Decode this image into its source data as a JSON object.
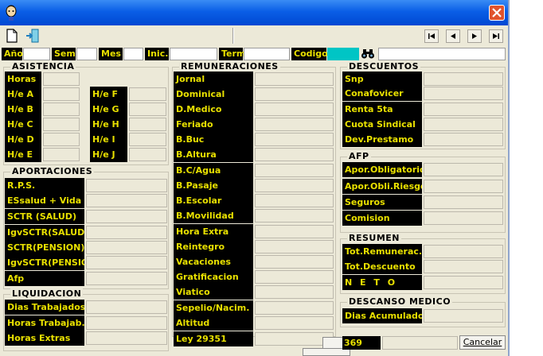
{
  "toolbar": {
    "new_icon": "new-document-icon",
    "exit_icon": "exit-door-icon",
    "nav": [
      "first-record-icon",
      "prev-record-icon",
      "next-record-icon",
      "last-record-icon"
    ]
  },
  "filter": {
    "anio": "Año",
    "sem": "Sem",
    "mes": "Mes",
    "inic": "Inic.",
    "term": "Term",
    "codigo": "Codigo",
    "search_icon": "binoculars-icon",
    "codigo_color": "#00c5c5"
  },
  "asistencia": {
    "title": "ASISTENCIA",
    "horas": "Horas",
    "left": [
      "H/e A",
      "H/e B",
      "H/e C",
      "H/e D",
      "H/e E"
    ],
    "right": [
      "H/e F",
      "H/e G",
      "H/e H",
      "H/e I",
      "H/e J"
    ]
  },
  "aportaciones": {
    "title": "APORTACIONES",
    "items": [
      "R.P.S.",
      "ESsalud + Vida",
      "SCTR (SALUD)",
      "IgvSCTR(SALUD",
      "SCTR(PENSION)",
      "IgvSCTR(PENSIO",
      "Afp"
    ]
  },
  "liquidacion": {
    "title": "LIQUIDACION",
    "items": [
      "Dias Trabajados",
      "Horas Trabajab.",
      "Horas Extras"
    ]
  },
  "remuneraciones": {
    "title": "REMUNERACIONES",
    "items": [
      "Jornal",
      "Dominical",
      "D.Medico",
      "Feriado",
      "B.Buc",
      "B.Altura",
      "B.C/Agua",
      "B.Pasaje",
      "B.Escolar",
      "B.Movilidad",
      "Hora Extra",
      "Reintegro",
      "Vacaciones",
      "Gratificacion",
      "Viatico",
      "Sepelio/Nacim.",
      "Altitud",
      "Ley 29351"
    ]
  },
  "descuentos": {
    "title": "DESCUENTOS",
    "items": [
      "Snp",
      "Conafovicer",
      "Renta 5ta",
      "Cuota Sindical",
      "Dev.Prestamo"
    ]
  },
  "afp": {
    "title": "AFP",
    "items": [
      "Apor.Obligatorio",
      "Apor.Obli.Riesgo",
      "Seguros",
      "Comision"
    ]
  },
  "resumen": {
    "title": "RESUMEN",
    "items": [
      "Tot.Remunerac.",
      "Tot.Descuento",
      "N E T O"
    ]
  },
  "descanso": {
    "title": "DESCANSO MEDICO",
    "items": [
      "Dias Acumulados"
    ]
  },
  "status": {
    "number": "369",
    "cancel": "Cancelar"
  }
}
